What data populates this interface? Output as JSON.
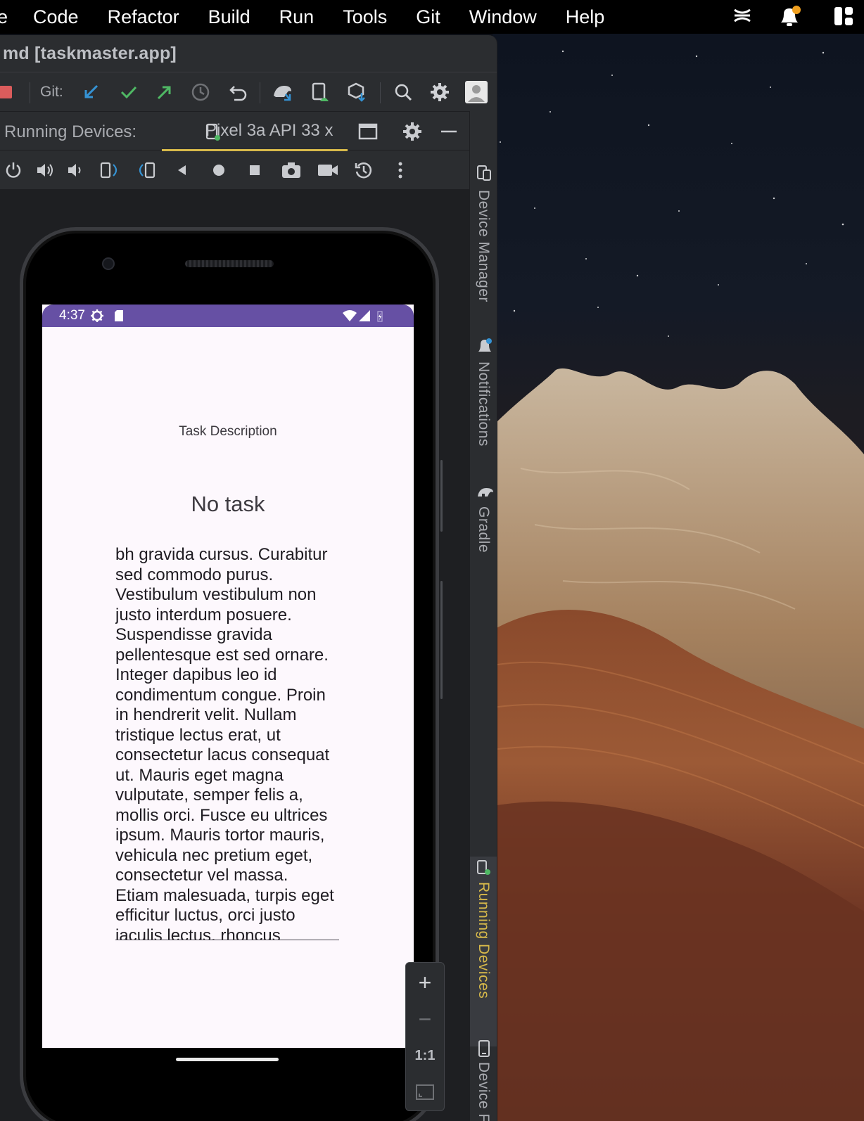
{
  "menubar": {
    "items": [
      "e",
      "Code",
      "Refactor",
      "Build",
      "Run",
      "Tools",
      "Git",
      "Window",
      "Help"
    ]
  },
  "window": {
    "title": "md [taskmaster.app]",
    "git_label": "Git:"
  },
  "running_devices": {
    "label": "Running Devices:",
    "tab_label": "Pixel 3a API 33 x"
  },
  "device": {
    "status_time": "4:37",
    "screen_heading": "Task Description",
    "task_name": "No task",
    "task_description_lines": [
      "bh gravida cursus. Curabitur",
      "sed commodo purus.",
      "Vestibulum vestibulum non",
      "justo interdum posuere.",
      "Suspendisse gravida",
      "pellentesque est sed ornare.",
      "Integer dapibus leo id",
      "condimentum congue. Proin",
      "in hendrerit velit. Nullam",
      "tristique lectus erat, ut",
      "consectetur lacus consequat",
      "ut. Mauris eget magna",
      "vulputate, semper felis a,",
      "mollis orci. Fusce eu ultrices",
      "ipsum. Mauris tortor mauris,",
      "vehicula nec pretium eget,",
      "consectetur vel massa.",
      "Etiam malesuada, turpis eget",
      "efficitur luctus, orci justo",
      "iaculis lectus, rhoncus"
    ]
  },
  "zoom_controls": {
    "zoom_in": "+",
    "zoom_out": "−",
    "actual_size": "1:1"
  },
  "tool_windows": {
    "device_manager": "Device Manager",
    "notifications": "Notifications",
    "gradle": "Gradle",
    "running_devices": "Running Devices",
    "device_file": "Device File"
  },
  "colors": {
    "accent_yellow": "#d7b94a",
    "status_bar_purple": "#6650a4",
    "git_blue": "#3592d3",
    "git_green": "#4fb864",
    "ide_bg": "#2b2d30"
  }
}
